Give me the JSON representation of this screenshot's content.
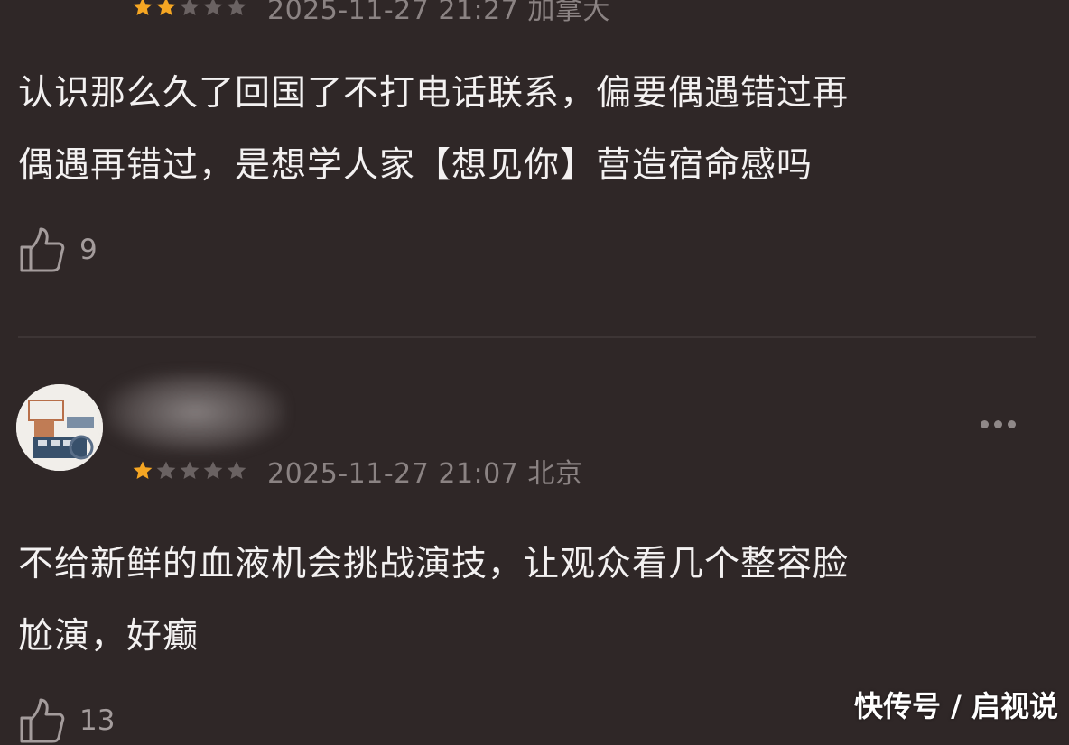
{
  "colors": {
    "background": "#2f2727",
    "star_filled": "#f5a623",
    "star_empty": "#6a6262",
    "meta_text": "#8b8383",
    "body_text": "#f3f1f1"
  },
  "comments": [
    {
      "rating": 2,
      "max_rating": 5,
      "meta": "2025-11-27 21:27 加拿大",
      "text_lines": [
        "认识那么久了回国了不打电话联系，偏要偶遇错过再",
        "偶遇再错过，是想学人家【想见你】营造宿命感吗"
      ],
      "likes": "9",
      "like_icon": "thumbs-up-icon"
    },
    {
      "rating": 1,
      "max_rating": 5,
      "meta": "2025-11-27 21:07 北京",
      "text_lines": [
        "不给新鲜的血液机会挑战演技，让观众看几个整容脸",
        "尬演，好癫"
      ],
      "likes": "13",
      "like_icon": "thumbs-up-icon",
      "more_icon": "more-dots-icon"
    }
  ],
  "watermark": "快传号 / 启视说"
}
